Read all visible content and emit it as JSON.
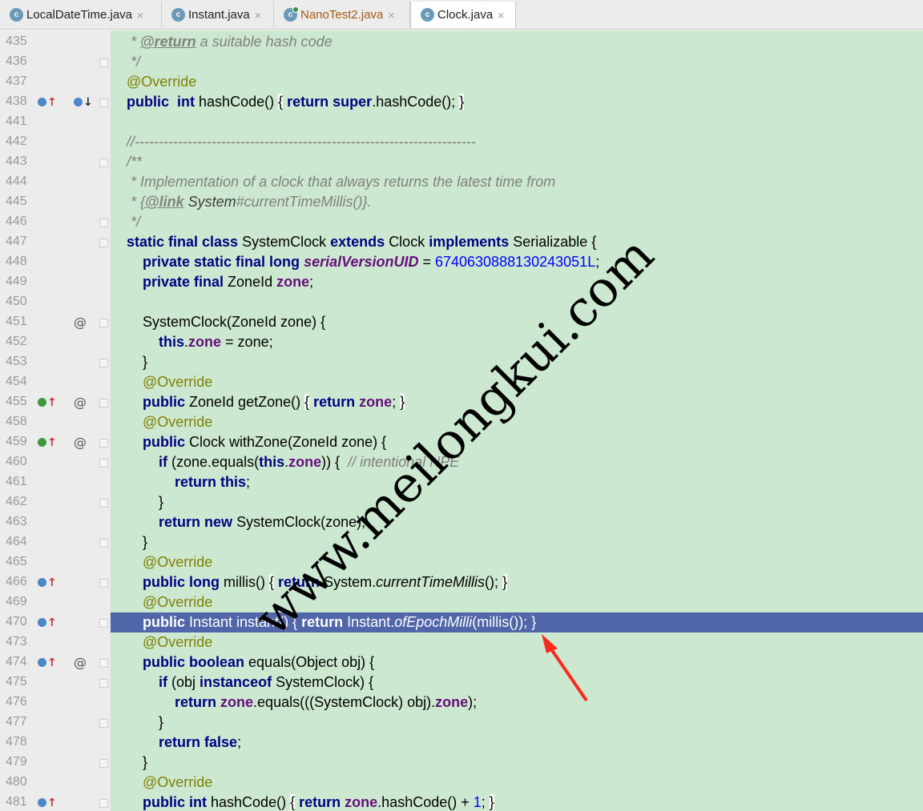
{
  "tabs": [
    {
      "label": "LocalDateTime.java",
      "icon": "java-class-icon",
      "close": "×"
    },
    {
      "label": "Instant.java",
      "icon": "java-class-icon",
      "close": "×"
    },
    {
      "label": "NanoTest2.java",
      "icon": "java-runnable-class-icon",
      "close": "×"
    },
    {
      "label": "Clock.java",
      "icon": "java-class-icon",
      "close": "×",
      "active": true
    }
  ],
  "tab_icon_letter": "c",
  "lines": [
    {
      "num": "435"
    },
    {
      "num": "436"
    },
    {
      "num": "437"
    },
    {
      "num": "438"
    },
    {
      "num": "441"
    },
    {
      "num": "442"
    },
    {
      "num": "443"
    },
    {
      "num": "444"
    },
    {
      "num": "445"
    },
    {
      "num": "446"
    },
    {
      "num": "447"
    },
    {
      "num": "448"
    },
    {
      "num": "449"
    },
    {
      "num": "450"
    },
    {
      "num": "451"
    },
    {
      "num": "452"
    },
    {
      "num": "453"
    },
    {
      "num": "454"
    },
    {
      "num": "455"
    },
    {
      "num": "458"
    },
    {
      "num": "459"
    },
    {
      "num": "460"
    },
    {
      "num": "461"
    },
    {
      "num": "462"
    },
    {
      "num": "463"
    },
    {
      "num": "464"
    },
    {
      "num": "465"
    },
    {
      "num": "466"
    },
    {
      "num": "469"
    },
    {
      "num": "470"
    },
    {
      "num": "473"
    },
    {
      "num": "474"
    },
    {
      "num": "475"
    },
    {
      "num": "476"
    },
    {
      "num": "477"
    },
    {
      "num": "478"
    },
    {
      "num": "479"
    },
    {
      "num": "480"
    },
    {
      "num": "481"
    }
  ],
  "gutter_at": "@",
  "gutter_up": "↑",
  "gutter_down": "↓",
  "code": {
    "l435": [
      " * ",
      "@return",
      " a suitable hash code"
    ],
    "l436": " */",
    "l437": "@Override",
    "l438": [
      "public",
      "int",
      "hashCode()",
      "{",
      "return",
      "super",
      ".hashCode();",
      "}"
    ],
    "l442": "//-----------------------------------------------------------------------",
    "l443": "/**",
    "l444": " * Implementation of a clock that always returns the latest time from",
    "l445": [
      " * ",
      "{",
      "@link",
      " System",
      "#currentTimeMillis()",
      "}."
    ],
    "l446": " */",
    "l447": [
      "static final class",
      "SystemClock",
      "extends",
      "Clock",
      "implements",
      "Serializable {"
    ],
    "l448": [
      "private static final long",
      "serialVersionUID",
      " = ",
      "6740630888130243051L",
      ";"
    ],
    "l449": [
      "private final",
      "ZoneId",
      "zone",
      ";"
    ],
    "l451": "SystemClock(ZoneId zone) {",
    "l452": [
      "this",
      ".",
      "zone",
      " = zone;"
    ],
    "l453": "}",
    "l454": "@Override",
    "l455": [
      "public",
      "ZoneId getZone()",
      "{",
      "return",
      "zone",
      ";",
      "}"
    ],
    "l458": "@Override",
    "l459": [
      "public",
      "Clock withZone(ZoneId zone) {"
    ],
    "l460": [
      "if",
      "(zone.equals(",
      "this",
      ".",
      "zone",
      ")) {",
      "// intentional NPE"
    ],
    "l461": [
      "return",
      "this",
      ";"
    ],
    "l462": "}",
    "l463": [
      "return",
      "new",
      "SystemClock(zone);"
    ],
    "l464": "}",
    "l465": "@Override",
    "l466": [
      "public long",
      "millis()",
      "{",
      "return",
      "System.",
      "currentTimeMillis",
      "();",
      "}"
    ],
    "l469": "@Override",
    "l470": [
      "public",
      "Instant instant()",
      "{",
      "return",
      "Instant.",
      "ofEpochMilli",
      "(millis());",
      "}"
    ],
    "l473": "@Override",
    "l474": [
      "public boolean",
      "equals(Object obj) {"
    ],
    "l475": [
      "if",
      "(obj",
      "instanceof",
      "SystemClock) {"
    ],
    "l476": [
      "return",
      "zone",
      ".equals(((SystemClock) obj).",
      "zone",
      ");"
    ],
    "l477": "}",
    "l478": [
      "return",
      "false",
      ";"
    ],
    "l479": "}",
    "l480": "@Override",
    "l481": [
      "public int",
      "hashCode()",
      "{",
      "return",
      "zone",
      ".hashCode() + ",
      "1",
      ";",
      "}"
    ]
  },
  "watermark": "www.meilongkui.com",
  "colors": {
    "editor_bg": "#cce8d0",
    "selection": "#5066a8",
    "keyword": "#000080",
    "annotation": "#808000",
    "comment": "#808080",
    "field": "#660e7a",
    "number": "#0000ff",
    "arrow": "#ff2a1a"
  }
}
